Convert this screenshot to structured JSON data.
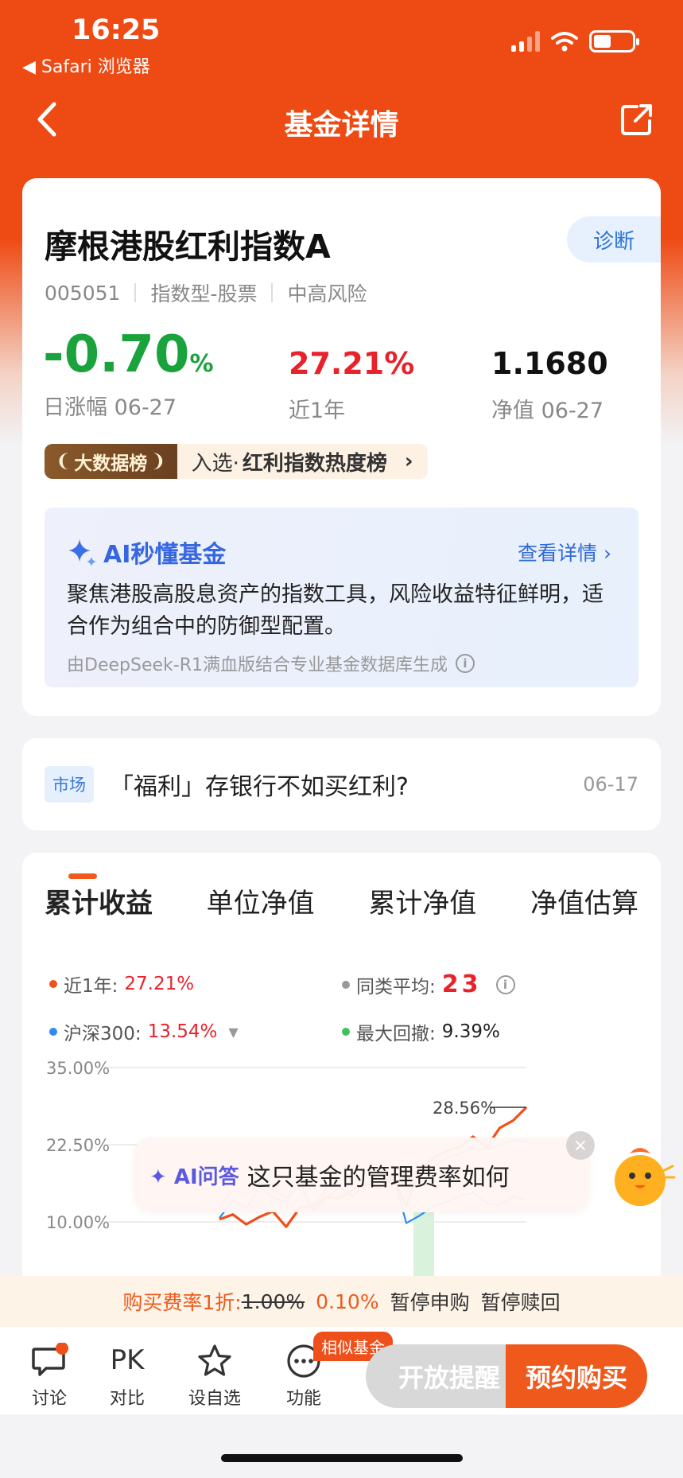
{
  "status": {
    "time": "16:25",
    "back_app": "◀ Safari 浏览器",
    "battery_level": 0.45
  },
  "nav": {
    "title": "基金详情"
  },
  "fund": {
    "name": "摩根港股红利指数A",
    "diagnose": "诊断",
    "code": "005051",
    "category": "指数型-股票",
    "risk": "中高风险",
    "day_change": "-0.70",
    "day_change_unit": "%",
    "day_change_label": "日涨幅 06-27",
    "year_return": "27.21%",
    "year_return_label": "近1年",
    "nav_value": "1.1680",
    "nav_label": "净值 06-27",
    "rank_badge": "大数据榜",
    "rank_prefix": "入选·",
    "rank_name": "红利指数热度榜"
  },
  "ai_summary": {
    "title": "AI秒懂基金",
    "link": "查看详情",
    "body": "聚焦港股高股息资产的指数工具，风险收益特征鲜明，适合作为组合中的防御型配置。",
    "footer": "由DeepSeek-R1满血版结合专业基金数据库生成"
  },
  "news": {
    "tag": "市场",
    "title": "「福利」存银行不如买红利?",
    "date": "06-17"
  },
  "chart": {
    "tabs": [
      "累计收益",
      "单位净值",
      "累计净值",
      "净值估算"
    ],
    "legend": {
      "fund_label": "近1年:",
      "fund_value": "27.21%",
      "peer_label": "同类平均:",
      "peer_value": "23",
      "index_label": "沪深300:",
      "index_value": "13.54%",
      "drawdown_label": "最大回撤:",
      "drawdown_value": "9.39%"
    },
    "colors": {
      "fund": "#f2501a",
      "index": "#2f8bef",
      "peer": "#999999",
      "drawdown": "#3cc25a"
    }
  },
  "chart_data": {
    "type": "line",
    "ylim": [
      10,
      35
    ],
    "y_ticks": [
      "35.00%",
      "22.50%",
      "10.00%"
    ],
    "annotations": [
      "28.56%"
    ],
    "series": [
      {
        "name": "近1年",
        "values": [
          10.4,
          11.2,
          9.6,
          10.8,
          11.7,
          9.2,
          12.2,
          12.5,
          14.0,
          13.8,
          15.3,
          16.1,
          15.8,
          17.2,
          12.6,
          18.4,
          20.3,
          21.5,
          22.1,
          23.8,
          22.0,
          25.2,
          26.4,
          28.56
        ]
      },
      {
        "name": "沪深300",
        "values": [
          10.6,
          13.5,
          12.2,
          15.6,
          14.0,
          13.1,
          16.8,
          11.7,
          13.9,
          15.6,
          14.2,
          16.3,
          15.4,
          17.8,
          9.8,
          11.0,
          12.5,
          13.2,
          14.2,
          14.7,
          13.1,
          12.7,
          14.1,
          13.54
        ]
      },
      {
        "name": "同类平均",
        "values": [
          12.2,
          15.1,
          14.4,
          16.3,
          15.2,
          14.0,
          15.6,
          12.3,
          15.3,
          17.8,
          16.6,
          18.1,
          17.9,
          19.1,
          17.4,
          17.9,
          18.8,
          20.3,
          21.0,
          21.9,
          21.7,
          22.5,
          23.2,
          23.0
        ]
      }
    ]
  },
  "ai_ask": {
    "tag": "AI问答",
    "question": "这只基金的管理费率如何"
  },
  "fee": {
    "label": "购买费率1折:",
    "original": "1.00%",
    "discounted": "0.10%",
    "purchase_status": "暂停申购",
    "redeem_status": "暂停赎回"
  },
  "toolbar": {
    "discuss": "讨论",
    "compare_icon": "PK",
    "compare": "对比",
    "watchlist": "设自选",
    "more": "功能",
    "similar_badge": "相似基金",
    "remind": "开放提醒",
    "buy": "预约购买"
  }
}
